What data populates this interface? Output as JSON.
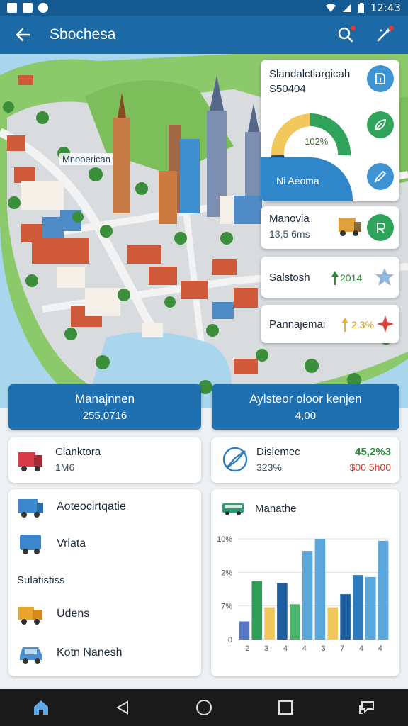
{
  "status_bar": {
    "time": "12:43"
  },
  "app_bar": {
    "title": "Sbochesa"
  },
  "map": {
    "label": "Mnooerican"
  },
  "overlay_cards": {
    "primary": {
      "title": "Slandalctlargicah",
      "subtitle": "S50404",
      "gauge_value": "102%",
      "band_label": "Ni Aeoma"
    },
    "card_two": {
      "title": "Manovia",
      "value": "13,5 6ms"
    },
    "card_three": {
      "title": "Salstosh",
      "value": "2014"
    },
    "card_four": {
      "title": "Pannajemai",
      "value": "2.3%"
    }
  },
  "summary": [
    {
      "title": "Manajnnen",
      "value": "255,0716"
    },
    {
      "title": "Aylsteor oloor kenjen",
      "value": "4,00"
    }
  ],
  "cards": {
    "left_top": {
      "title": "Clanktora",
      "value": "1M6"
    },
    "right_top": {
      "title": "Dislemec",
      "value": "323%",
      "stat_up": "45,2%3",
      "stat_down": "$00 5h00"
    },
    "left_list": {
      "items": [
        {
          "label": "Aoteocirtqatie"
        },
        {
          "label": "Vriata"
        }
      ],
      "section_label": "Sulatistiss",
      "items2": [
        {
          "label": "Udens"
        },
        {
          "label": "Kotn Nanesh"
        }
      ]
    },
    "right_chart": {
      "title": "Manathe"
    }
  },
  "chart_data": {
    "type": "bar",
    "title": "Manathe",
    "y_tick_labels": [
      "0",
      "7%",
      "2%",
      "10%"
    ],
    "ylim": [
      0,
      100
    ],
    "x_tick_labels": [
      "2",
      "3",
      "4",
      "4",
      "3",
      "7",
      "4",
      "4"
    ],
    "values": [
      18,
      58,
      32,
      56,
      35,
      88,
      100,
      32,
      45,
      64,
      62,
      98
    ],
    "colors": [
      "#5577c4",
      "#2f9e56",
      "#f0c85c",
      "#1f5fa0",
      "#4cb36a",
      "#5aa8dc",
      "#5aa8dc",
      "#f0c85c",
      "#1f5fa0",
      "#2f79bf",
      "#5aa8dc",
      "#5aa8dc"
    ]
  }
}
